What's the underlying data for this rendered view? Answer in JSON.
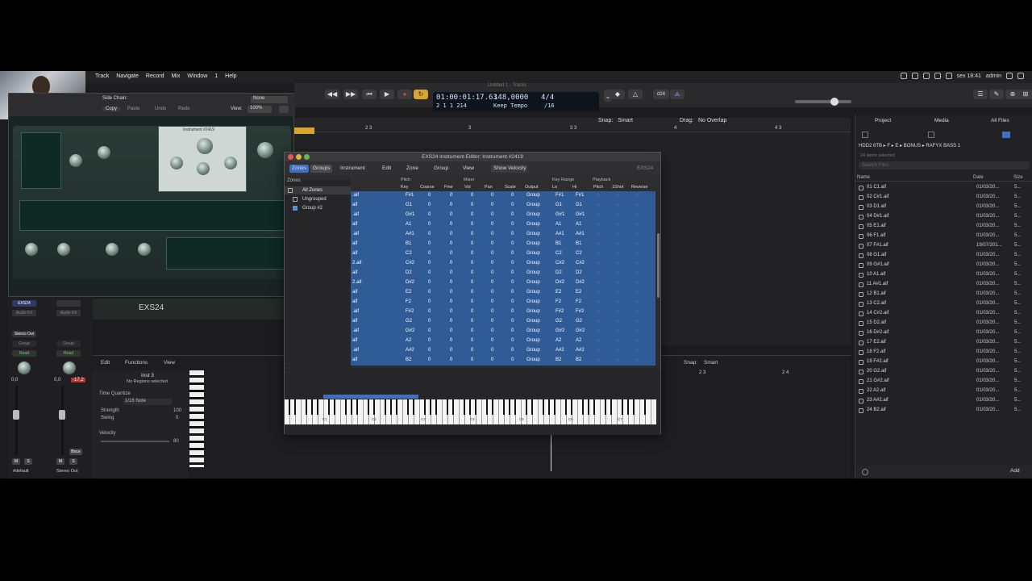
{
  "menubar": {
    "items": [
      "Track",
      "Navigate",
      "Record",
      "Mix",
      "Window",
      "1",
      "Help"
    ],
    "clock": "sex 18:41",
    "user": "admin"
  },
  "window_title": "Untitled 1 - Tracks",
  "transport": {
    "smpte": "01:00:01:17.63",
    "bars": "2  1  1  214",
    "tempo": "148,0000",
    "tempo_label": "Keep Tempo",
    "signature": "4/4",
    "division": "/16",
    "key": "Cmaj",
    "cpu_label": "d24"
  },
  "track_toolbar": {
    "snap_label": "Snap:",
    "snap_value": "Smart",
    "drag_label": "Drag:",
    "drag_value": "No Overlap",
    "ruler_marks": [
      "2 3",
      "3",
      "3 3",
      "4",
      "4 3"
    ]
  },
  "plugin": {
    "buttons": [
      "Copy",
      "Paste",
      "Undo",
      "Redo"
    ],
    "view_label": "View:",
    "view_value": "100%",
    "side_chain_label": "Side Chain:",
    "side_chain_value": "None",
    "instrument_label": "Instrument #2419",
    "name": "EXS24"
  },
  "mixer": {
    "strip1": {
      "name": "EXS24",
      "audio_fx": "Audio FX",
      "output": "Stereo Out",
      "group": "Group",
      "read": "Read",
      "volume": "0,0",
      "mute": "M",
      "solo": "S",
      "label": "#default"
    },
    "strip2": {
      "audio_fx": "Audio FX",
      "group": "Group",
      "read": "Read",
      "volume": "0,0",
      "peak": "-17,2",
      "mute": "M",
      "solo": "S",
      "bounce": "Bnce",
      "label": "Stereo Out"
    }
  },
  "pianoroll": {
    "menu": [
      "Edit",
      "Functions",
      "View"
    ],
    "region_name": "Inst 3",
    "region_sub": "No Regions selected",
    "time_quantize_label": "Time Quantize",
    "quantize_value": "1/16 Note",
    "strength_label": "Strength",
    "strength_value": "100",
    "swing_label": "Swing",
    "swing_value": "0",
    "velocity_label": "Velocity",
    "velocity_value": "80",
    "snap_label": "Snap:",
    "snap_value": "Smart",
    "ruler_marks": [
      "2 3",
      "2 4"
    ]
  },
  "exs": {
    "title": "EXS24 Instrument Editor: Instrument #2419",
    "tabs": [
      "Zones",
      "Groups"
    ],
    "menus": [
      "Instrument",
      "Edit",
      "Zone",
      "Group",
      "View"
    ],
    "show_velocity": "Show Velocity",
    "badge": "EXS24",
    "sidebar_header": "Zones",
    "sidebar_items": [
      "All Zones",
      "Ungrouped",
      "Group #2"
    ],
    "group_headers": [
      "Pitch",
      "Mixer",
      "Key Range",
      "Playback"
    ],
    "columns": [
      "Key",
      "Coarse",
      "Fine",
      "Vol",
      "Pan",
      "Scale",
      "Output",
      "Lo",
      "Hi",
      "Pitch",
      "1Shot",
      "Reverse"
    ],
    "rows": [
      {
        "file": ".aif",
        "key": "F#1",
        "coarse": "0",
        "fine": "0",
        "vol": "0",
        "pan": "0",
        "scale": "0",
        "output": "Group",
        "lo": "F#1",
        "hi": "F#1"
      },
      {
        "file": "aif",
        "key": "G1",
        "coarse": "0",
        "fine": "0",
        "vol": "0",
        "pan": "0",
        "scale": "0",
        "output": "Group",
        "lo": "G1",
        "hi": "G1"
      },
      {
        "file": ".aif",
        "key": "G#1",
        "coarse": "0",
        "fine": "0",
        "vol": "0",
        "pan": "0",
        "scale": "0",
        "output": "Group",
        "lo": "G#1",
        "hi": "G#1"
      },
      {
        "file": "aif",
        "key": "A1",
        "coarse": "0",
        "fine": "0",
        "vol": "0",
        "pan": "0",
        "scale": "0",
        "output": "Group",
        "lo": "A1",
        "hi": "A1"
      },
      {
        "file": ".aif",
        "key": "A#1",
        "coarse": "0",
        "fine": "0",
        "vol": "0",
        "pan": "0",
        "scale": "0",
        "output": "Group",
        "lo": "A#1",
        "hi": "A#1"
      },
      {
        "file": "aif",
        "key": "B1",
        "coarse": "0",
        "fine": "0",
        "vol": "0",
        "pan": "0",
        "scale": "0",
        "output": "Group",
        "lo": "B1",
        "hi": "B1"
      },
      {
        "file": "aif",
        "key": "C2",
        "coarse": "0",
        "fine": "0",
        "vol": "0",
        "pan": "0",
        "scale": "0",
        "output": "Group",
        "lo": "C2",
        "hi": "C2"
      },
      {
        "file": "2.aif",
        "key": "C#2",
        "coarse": "0",
        "fine": "0",
        "vol": "0",
        "pan": "0",
        "scale": "0",
        "output": "Group",
        "lo": "C#2",
        "hi": "C#2"
      },
      {
        "file": "aif",
        "key": "D2",
        "coarse": "0",
        "fine": "0",
        "vol": "0",
        "pan": "0",
        "scale": "0",
        "output": "Group",
        "lo": "D2",
        "hi": "D2"
      },
      {
        "file": "2.aif",
        "key": "D#2",
        "coarse": "0",
        "fine": "0",
        "vol": "0",
        "pan": "0",
        "scale": "0",
        "output": "Group",
        "lo": "D#2",
        "hi": "D#2"
      },
      {
        "file": "aif",
        "key": "E2",
        "coarse": "0",
        "fine": "0",
        "vol": "0",
        "pan": "0",
        "scale": "0",
        "output": "Group",
        "lo": "E2",
        "hi": "E2"
      },
      {
        "file": "aif",
        "key": "F2",
        "coarse": "0",
        "fine": "0",
        "vol": "0",
        "pan": "0",
        "scale": "0",
        "output": "Group",
        "lo": "F2",
        "hi": "F2"
      },
      {
        "file": ".aif",
        "key": "F#2",
        "coarse": "0",
        "fine": "0",
        "vol": "0",
        "pan": "0",
        "scale": "0",
        "output": "Group",
        "lo": "F#2",
        "hi": "F#2"
      },
      {
        "file": "aif",
        "key": "G2",
        "coarse": "0",
        "fine": "0",
        "vol": "0",
        "pan": "0",
        "scale": "0",
        "output": "Group",
        "lo": "G2",
        "hi": "G2"
      },
      {
        "file": ".aif",
        "key": "G#2",
        "coarse": "0",
        "fine": "0",
        "vol": "0",
        "pan": "0",
        "scale": "0",
        "output": "Group",
        "lo": "G#2",
        "hi": "G#2"
      },
      {
        "file": "aif",
        "key": "A2",
        "coarse": "0",
        "fine": "0",
        "vol": "0",
        "pan": "0",
        "scale": "0",
        "output": "Group",
        "lo": "A2",
        "hi": "A2"
      },
      {
        "file": ".aif",
        "key": "A#2",
        "coarse": "0",
        "fine": "0",
        "vol": "0",
        "pan": "0",
        "scale": "0",
        "output": "Group",
        "lo": "A#2",
        "hi": "A#2"
      },
      {
        "file": "aif",
        "key": "B2",
        "coarse": "0",
        "fine": "0",
        "vol": "0",
        "pan": "0",
        "scale": "0",
        "output": "Group",
        "lo": "B2",
        "hi": "B2"
      }
    ],
    "keyboard_labels": [
      "C1",
      "C2",
      "C3",
      "C4",
      "C5",
      "C6",
      "C7"
    ]
  },
  "browser": {
    "tabs": [
      "Project",
      "Media",
      "All Files"
    ],
    "path": "HDD2 6TB ▸ F ▸ E ▸ BONUS ▸ RAFYX BASS 1",
    "selection": "24 items selected",
    "search_placeholder": "Search Files",
    "columns": [
      "Name",
      "Date",
      "Size"
    ],
    "files": [
      {
        "name": "01 C1.aif",
        "date": "01/03/20...",
        "size": "5..."
      },
      {
        "name": "02 C#1.aif",
        "date": "01/03/20...",
        "size": "5..."
      },
      {
        "name": "03 D1.aif",
        "date": "01/03/20...",
        "size": "5..."
      },
      {
        "name": "04 D#1.aif",
        "date": "01/03/20...",
        "size": "5..."
      },
      {
        "name": "05 E1.aif",
        "date": "01/03/20...",
        "size": "5..."
      },
      {
        "name": "06 F1.aif",
        "date": "01/03/20...",
        "size": "5..."
      },
      {
        "name": "07 F#1.aif",
        "date": "19/07/201...",
        "size": "5..."
      },
      {
        "name": "08 G1.aif",
        "date": "01/03/20...",
        "size": "5..."
      },
      {
        "name": "09 G#1.aif",
        "date": "01/03/20...",
        "size": "5..."
      },
      {
        "name": "10 A1.aif",
        "date": "01/03/20...",
        "size": "5..."
      },
      {
        "name": "11 A#1.aif",
        "date": "01/03/20...",
        "size": "5..."
      },
      {
        "name": "12 B1.aif",
        "date": "01/03/20...",
        "size": "5..."
      },
      {
        "name": "13 C2.aif",
        "date": "01/03/20...",
        "size": "5..."
      },
      {
        "name": "14 C#2.aif",
        "date": "01/03/20...",
        "size": "5..."
      },
      {
        "name": "15 D2.aif",
        "date": "01/03/20...",
        "size": "5..."
      },
      {
        "name": "16 D#2.aif",
        "date": "01/03/20...",
        "size": "5..."
      },
      {
        "name": "17 E2.aif",
        "date": "01/03/20...",
        "size": "5..."
      },
      {
        "name": "18 F2.aif",
        "date": "01/03/20...",
        "size": "5..."
      },
      {
        "name": "19 F#2.aif",
        "date": "01/03/20...",
        "size": "5..."
      },
      {
        "name": "20 G2.aif",
        "date": "01/03/20...",
        "size": "5..."
      },
      {
        "name": "21 G#2.aif",
        "date": "01/03/20...",
        "size": "5..."
      },
      {
        "name": "22 A2.aif",
        "date": "01/03/20...",
        "size": "5..."
      },
      {
        "name": "23 A#2.aif",
        "date": "01/03/20...",
        "size": "5..."
      },
      {
        "name": "24 B2.aif",
        "date": "01/03/20...",
        "size": "5..."
      }
    ],
    "add_button": "Add"
  },
  "colors": {
    "selection_blue": "#2f5b97",
    "record_red": "#e0403a",
    "cycle_yellow": "#d9a52d",
    "accent_blue": "#3f6fc0"
  }
}
